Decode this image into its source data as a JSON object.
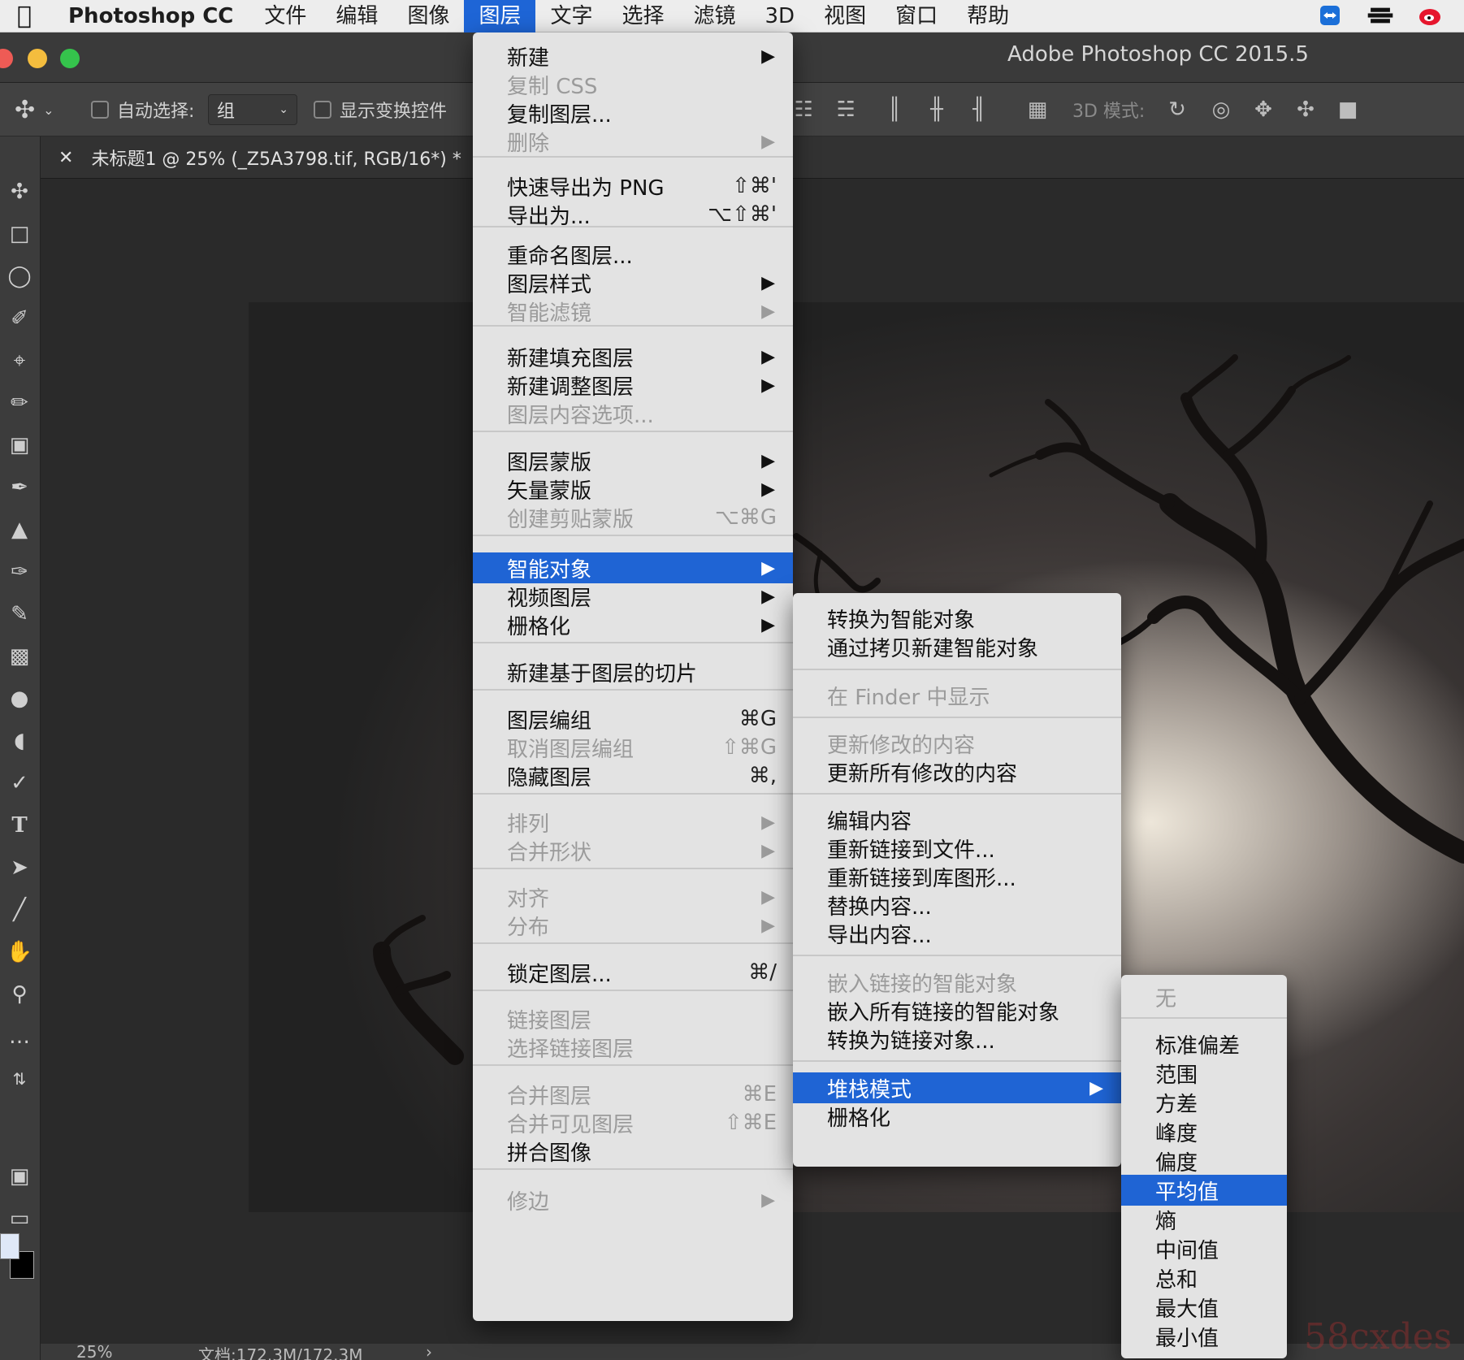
{
  "menubar": {
    "app_name": "Photoshop CC",
    "items": [
      "文件",
      "编辑",
      "图像",
      "图层",
      "文字",
      "选择",
      "滤镜",
      "3D",
      "视图",
      "窗口",
      "帮助"
    ],
    "active": "图层"
  },
  "window": {
    "title": "Adobe Photoshop CC 2015.5"
  },
  "options": {
    "auto_select_label": "自动选择:",
    "group_value": "组",
    "show_transform_label": "显示变换控件",
    "mode_3d_label": "3D 模式:"
  },
  "document": {
    "tab_title": "未标题1 @ 25% (_Z5A3798.tif, RGB/16*) *"
  },
  "status": {
    "zoom": "25%",
    "doc_size": "文档:172.3M/172.3M"
  },
  "layer_menu": [
    {
      "label": "新建",
      "arrow": true
    },
    {
      "label": "复制 CSS",
      "disabled": true
    },
    {
      "label": "复制图层..."
    },
    {
      "label": "删除",
      "disabled": true,
      "arrow": true
    },
    {
      "label": "快速导出为 PNG",
      "shortcut": "⇧⌘'"
    },
    {
      "label": "导出为...",
      "shortcut": "⌥⇧⌘'"
    },
    {
      "label": "重命名图层..."
    },
    {
      "label": "图层样式",
      "arrow": true
    },
    {
      "label": "智能滤镜",
      "disabled": true,
      "arrow": true
    },
    {
      "label": "新建填充图层",
      "arrow": true
    },
    {
      "label": "新建调整图层",
      "arrow": true
    },
    {
      "label": "图层内容选项...",
      "disabled": true
    },
    {
      "label": "图层蒙版",
      "arrow": true
    },
    {
      "label": "矢量蒙版",
      "arrow": true
    },
    {
      "label": "创建剪贴蒙版",
      "disabled": true,
      "shortcut": "⌥⌘G"
    },
    {
      "label": "智能对象",
      "arrow": true,
      "highlighted": true
    },
    {
      "label": "视频图层",
      "arrow": true
    },
    {
      "label": "栅格化",
      "arrow": true
    },
    {
      "label": "新建基于图层的切片"
    },
    {
      "label": "图层编组",
      "shortcut": "⌘G"
    },
    {
      "label": "取消图层编组",
      "disabled": true,
      "shortcut": "⇧⌘G"
    },
    {
      "label": "隐藏图层",
      "shortcut": "⌘,"
    },
    {
      "label": "排列",
      "disabled": true,
      "arrow": true
    },
    {
      "label": "合并形状",
      "disabled": true,
      "arrow": true
    },
    {
      "label": "对齐",
      "disabled": true,
      "arrow": true
    },
    {
      "label": "分布",
      "disabled": true,
      "arrow": true
    },
    {
      "label": "锁定图层...",
      "shortcut": "⌘/"
    },
    {
      "label": "链接图层",
      "disabled": true
    },
    {
      "label": "选择链接图层",
      "disabled": true
    },
    {
      "label": "合并图层",
      "disabled": true,
      "shortcut": "⌘E"
    },
    {
      "label": "合并可见图层",
      "disabled": true,
      "shortcut": "⇧⌘E"
    },
    {
      "label": "拼合图像"
    },
    {
      "label": "修边",
      "disabled": true,
      "arrow": true
    }
  ],
  "smart_object_menu": [
    {
      "label": "转换为智能对象"
    },
    {
      "label": "通过拷贝新建智能对象"
    },
    {
      "label": "在 Finder 中显示",
      "disabled": true
    },
    {
      "label": "更新修改的内容",
      "disabled": true
    },
    {
      "label": "更新所有修改的内容"
    },
    {
      "label": "编辑内容"
    },
    {
      "label": "重新链接到文件..."
    },
    {
      "label": "重新链接到库图形..."
    },
    {
      "label": "替换内容..."
    },
    {
      "label": "导出内容..."
    },
    {
      "label": "嵌入链接的智能对象",
      "disabled": true
    },
    {
      "label": "嵌入所有链接的智能对象"
    },
    {
      "label": "转换为链接对象..."
    },
    {
      "label": "堆栈模式",
      "arrow": true,
      "highlighted": true
    },
    {
      "label": "栅格化"
    }
  ],
  "stack_mode_menu": [
    {
      "label": "无",
      "disabled": true
    },
    {
      "label": "标准偏差"
    },
    {
      "label": "范围"
    },
    {
      "label": "方差"
    },
    {
      "label": "峰度"
    },
    {
      "label": "偏度"
    },
    {
      "label": "平均值",
      "highlighted": true
    },
    {
      "label": "熵"
    },
    {
      "label": "中间值"
    },
    {
      "label": "总和"
    },
    {
      "label": "最大值"
    },
    {
      "label": "最小值"
    }
  ],
  "watermark": "58cxdes"
}
